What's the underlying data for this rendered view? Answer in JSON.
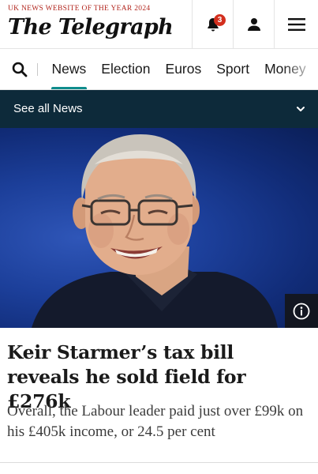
{
  "header": {
    "tagline": "UK NEWS WEBSITE OF THE YEAR 2024",
    "masthead": "The Telegraph",
    "notifications": {
      "icon": "bell-icon",
      "count": "3"
    },
    "account_icon": "person-icon",
    "menu_icon": "hamburger-icon"
  },
  "nav": {
    "search_icon": "search-icon",
    "items": [
      {
        "label": "News",
        "active": true
      },
      {
        "label": "Election",
        "active": false
      },
      {
        "label": "Euros",
        "active": false
      },
      {
        "label": "Sport",
        "active": false
      },
      {
        "label": "Money",
        "active": false
      }
    ],
    "accent": "#0f8c8c"
  },
  "section_bar": {
    "label": "See all News",
    "icon": "chevron-down-icon",
    "background": "#0d2a3a"
  },
  "article": {
    "info_icon": "info-icon",
    "headline": "Keir Starmer’s tax bill reveals he sold field for £276k",
    "standfirst": "Overall, the Labour leader paid just over £99k on his £405k income, or 24.5 per cent"
  }
}
